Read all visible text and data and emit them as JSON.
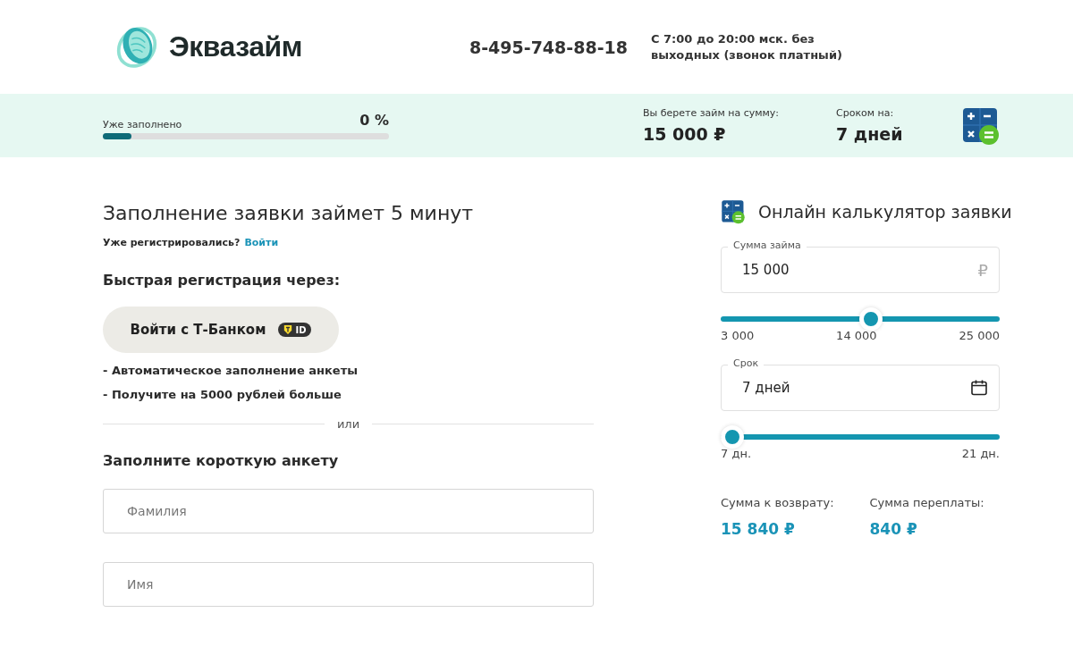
{
  "header": {
    "logo_text": "Эквазайм",
    "phone": "8-495-748-88-18",
    "hours": "С 7:00 до 20:00 мск. без выходных (звонок платный)"
  },
  "summary_bar": {
    "progress": {
      "label": "Уже заполнено",
      "value": "0 %",
      "level": 0.1
    },
    "amount": {
      "label": "Вы берете займ на сумму:",
      "value": "15 000 ₽"
    },
    "term": {
      "label": "Сроком на:",
      "value": "7 дней"
    }
  },
  "form": {
    "title": "Заполнение заявки займет 5 минут",
    "login_prompt": "Уже регистрировались?",
    "login_link": "Войти",
    "quick_title": "Быстрая регистрация через:",
    "tbank_button": "Войти с Т-Банком",
    "tbank_badge": "ID",
    "benefits": [
      "- Автоматическое заполнение анкеты",
      "- Получите на 5000 рублей больше"
    ],
    "divider_text": "или",
    "short_form_title": "Заполните короткую анкету",
    "fields": [
      {
        "placeholder": "Фамилия"
      },
      {
        "placeholder": "Имя"
      }
    ]
  },
  "calculator": {
    "title": "Онлайн калькулятор заявки",
    "amount_field": {
      "label": "Сумма займа",
      "value": "15 000",
      "suffix": "₽"
    },
    "amount_slider": {
      "level": 0.54,
      "ticks": [
        "3 000",
        "14 000",
        "25 000"
      ]
    },
    "term_field": {
      "label": "Срок",
      "value": "7 дней"
    },
    "term_slider": {
      "level": 0,
      "ticks": [
        "7 дн.",
        "21 дн."
      ]
    },
    "results": [
      {
        "label": "Сумма к возврату:",
        "value": "15 840 ₽"
      },
      {
        "label": "Сумма переплаты:",
        "value": "840 ₽"
      }
    ]
  }
}
